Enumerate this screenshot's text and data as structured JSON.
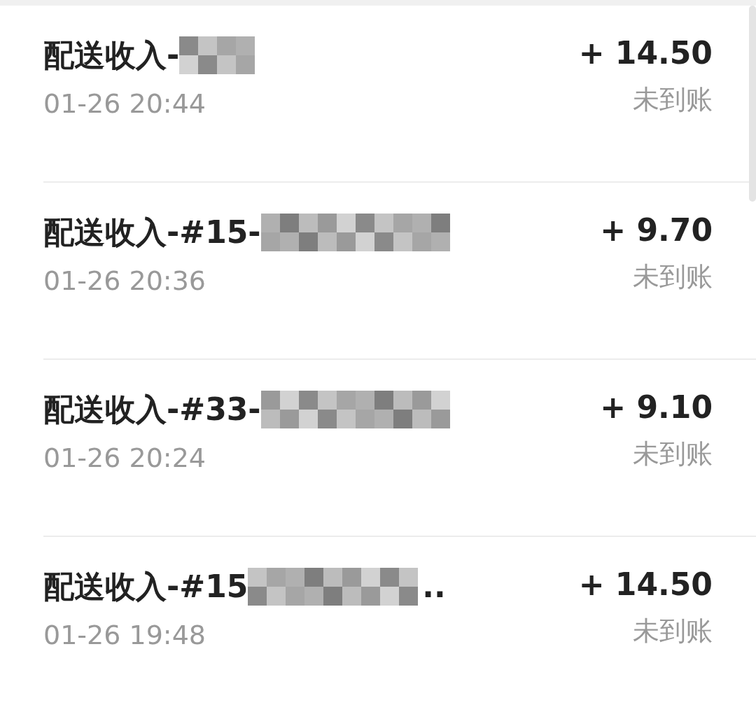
{
  "records": [
    {
      "title": "配送收入-",
      "redacted": true,
      "amount": "+ 14.50",
      "time": "01-26 20:44",
      "status": "未到账"
    },
    {
      "title": "配送收入-#15-",
      "redacted": true,
      "amount": "+ 9.70",
      "time": "01-26 20:36",
      "status": "未到账"
    },
    {
      "title": "配送收入-#33-",
      "redacted": true,
      "amount": "+ 9.10",
      "time": "01-26 20:24",
      "status": "未到账"
    },
    {
      "title": "配送收入-#15",
      "redacted": true,
      "tail": "..",
      "amount": "+ 14.50",
      "time": "01-26 19:48",
      "status": "未到账"
    }
  ]
}
